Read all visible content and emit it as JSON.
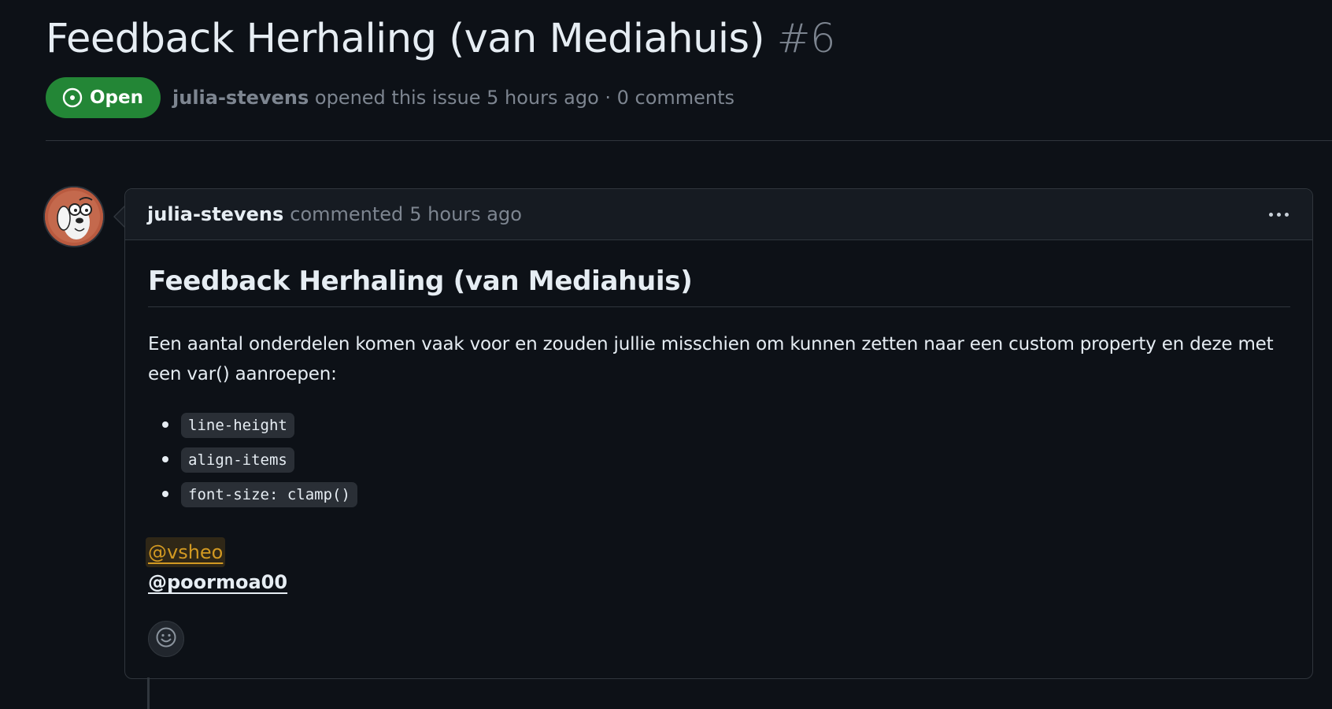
{
  "issue": {
    "title": "Feedback Herhaling (van Mediahuis)",
    "number": "#6",
    "state": "Open",
    "author": "julia-stevens",
    "meta_text": "opened this issue 5 hours ago · 0 comments"
  },
  "comment": {
    "author": "julia-stevens",
    "action": "commented",
    "time": "5 hours ago",
    "heading": "Feedback Herhaling (van Mediahuis)",
    "paragraph": "Een aantal onderdelen komen vaak voor en zouden jullie misschien om kunnen zetten naar een custom property en deze met een var() aanroepen:",
    "list_items": [
      "line-height",
      "align-items",
      "font-size: clamp()"
    ],
    "mentions": [
      "@vsheo",
      "@poormoa00"
    ]
  },
  "icons": {
    "state": "issue-opened-icon",
    "menu": "kebab-horizontal-icon",
    "reaction": "smiley-icon"
  },
  "colors": {
    "background": "#0d1117",
    "open_badge": "#238636",
    "muted_text": "#7d8590",
    "mention_highlight": "#d29922"
  }
}
